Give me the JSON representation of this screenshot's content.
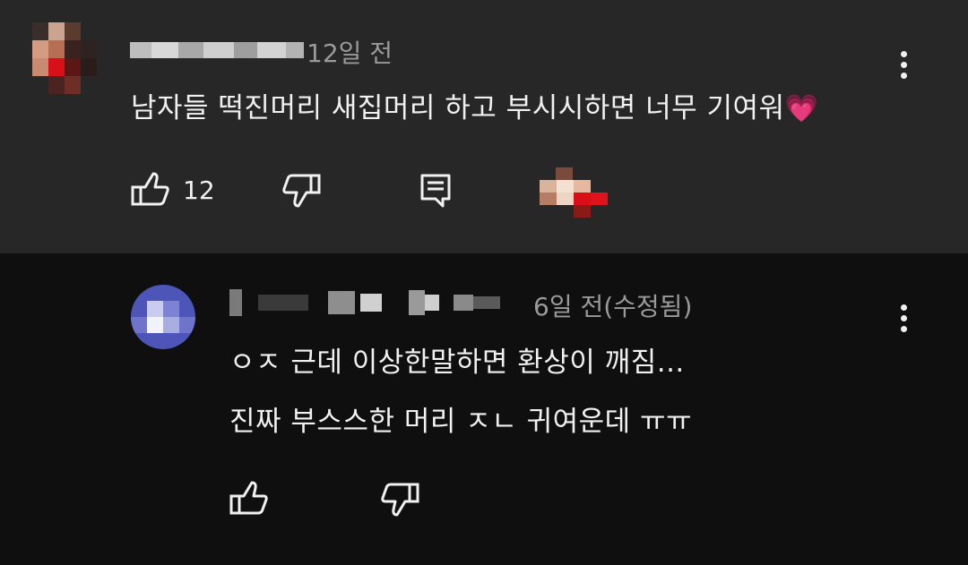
{
  "comments": [
    {
      "time": "12일 전",
      "text_before": "남자들 떡진머리 새집머리 하고 부시시하면 너무 기여워",
      "emoji": "💗",
      "likes": "12",
      "actions": [
        "like-icon",
        "dislike-icon",
        "reply-icon",
        "more-vert-icon"
      ]
    },
    {
      "time": "6일 전(수정됨)",
      "lines": [
        "ㅇㅈ 근데 이상한말하면 환상이 깨짐...",
        "진짜 부스스한 머리 ㅈㄴ 귀여운데 ㅠㅠ"
      ],
      "actions": [
        "like-icon",
        "dislike-icon",
        "more-vert-icon"
      ]
    }
  ],
  "colors": {
    "top_bg": "#272727",
    "reply_bg": "#0f0f0f",
    "text": "#f1f1f1",
    "meta": "#9a9a9a"
  }
}
